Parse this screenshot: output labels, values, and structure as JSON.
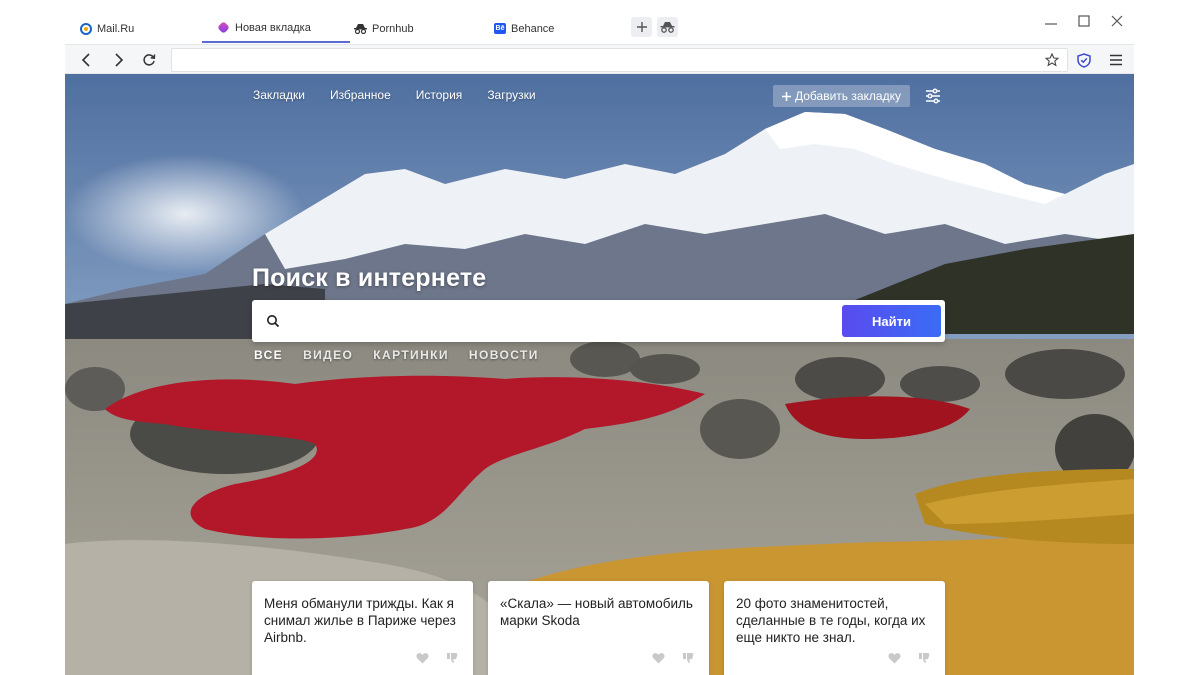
{
  "tabs": [
    {
      "label": "Mail.Ru",
      "icon": "mailru-icon"
    },
    {
      "label": "Новая вкладка",
      "icon": "new-tab-icon",
      "active": true
    },
    {
      "label": "Pornhub",
      "icon": "incognito-icon"
    },
    {
      "label": "Behance",
      "icon": "behance-icon"
    }
  ],
  "behance_badge": "Bē",
  "address": {
    "value": "",
    "placeholder": ""
  },
  "toplinks": [
    "Закладки",
    "Избранное",
    "История",
    "Загрузки"
  ],
  "add_bookmark": "Добавить закладку",
  "search": {
    "title": "Поиск в интернете",
    "placeholder": "",
    "button": "Найти",
    "tabs": [
      "ВСЕ",
      "ВИДЕО",
      "КАРТИНКИ",
      "НОВОСТИ"
    ]
  },
  "cards": [
    {
      "text": "Меня обманули трижды. Как я снимал жилье в Париже через Airbnb."
    },
    {
      "text": "«Скала» — новый автомобиль марки Skoda"
    },
    {
      "text": "20 фото знаменитостей, сделанные в те годы, когда их еще никто не знал."
    }
  ],
  "colors": {
    "accent": "#5a4bef",
    "active_tab_underline": "#5a6bd8"
  }
}
